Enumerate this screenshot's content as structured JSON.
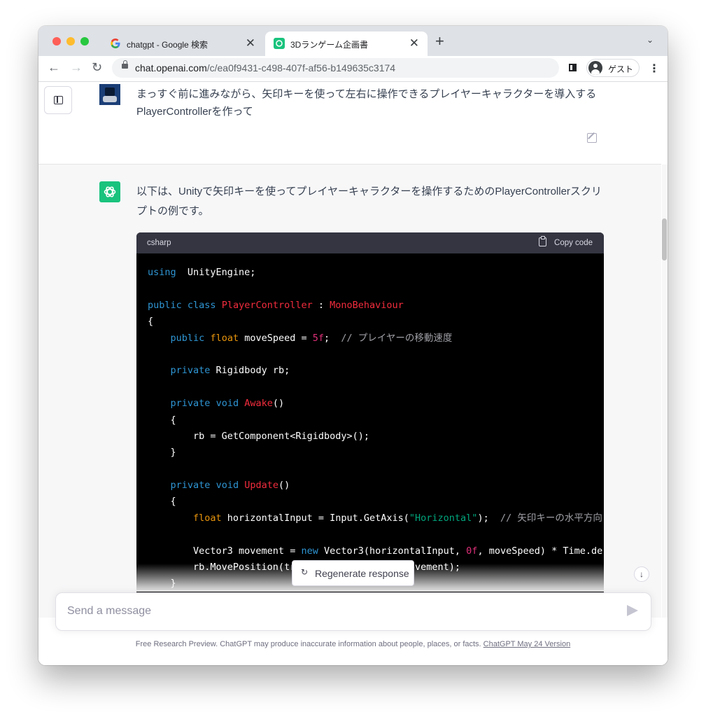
{
  "browser": {
    "tabs": [
      {
        "title": "chatgpt - Google 検索",
        "close": "✕"
      },
      {
        "title": "3Dランゲーム企画書",
        "close": "✕"
      }
    ],
    "new_tab": "+",
    "tab_menu": "⌄",
    "url_host": "chat.openai.com",
    "url_path": "/c/ea0f9431-c498-407f-af56-b149635c3174",
    "profile_label": "ゲスト",
    "menu": "⋮"
  },
  "chat": {
    "user_message": "まっすぐ前に進みながら、矢印キーを使って左右に操作できるプレイヤーキャラクターを導入するPlayerControllerを作って",
    "assistant_message": "以下は、Unityで矢印キーを使ってプレイヤーキャラクターを操作するためのPlayerControllerスクリプトの例です。",
    "code_language": "csharp",
    "copy_label": "Copy code",
    "regenerate_label": "Regenerate response",
    "input_placeholder": "Send a message",
    "footer_text": "Free Research Preview. ChatGPT may produce inaccurate information about people, places, or facts. ",
    "footer_link": "ChatGPT May 24 Version"
  },
  "code_lines": [
    [
      [
        "kw",
        "using"
      ],
      [
        "",
        "  UnityEngine;"
      ]
    ],
    [],
    [
      [
        "kw",
        "public"
      ],
      [
        "",
        " "
      ],
      [
        "kw",
        "class"
      ],
      [
        "",
        " "
      ],
      [
        "cls",
        "PlayerController"
      ],
      [
        "",
        " : "
      ],
      [
        "cls",
        "MonoBehaviour"
      ]
    ],
    [
      [
        "",
        "{"
      ]
    ],
    [
      [
        "",
        "    "
      ],
      [
        "kw",
        "public"
      ],
      [
        "",
        " "
      ],
      [
        "fl",
        "float"
      ],
      [
        "",
        " moveSpeed = "
      ],
      [
        "num",
        "5f"
      ],
      [
        "",
        ";  "
      ],
      [
        "cm",
        "// プレイヤーの移動速度"
      ]
    ],
    [],
    [
      [
        "",
        "    "
      ],
      [
        "kw",
        "private"
      ],
      [
        "",
        " Rigidbody rb;"
      ]
    ],
    [],
    [
      [
        "",
        "    "
      ],
      [
        "kw",
        "private"
      ],
      [
        "",
        " "
      ],
      [
        "kw",
        "void"
      ],
      [
        "",
        " "
      ],
      [
        "cls",
        "Awake"
      ],
      [
        "",
        "()"
      ]
    ],
    [
      [
        "",
        "    {"
      ]
    ],
    [
      [
        "",
        "        rb = GetComponent<Rigidbody>();"
      ]
    ],
    [
      [
        "",
        "    }"
      ]
    ],
    [],
    [
      [
        "",
        "    "
      ],
      [
        "kw",
        "private"
      ],
      [
        "",
        " "
      ],
      [
        "kw",
        "void"
      ],
      [
        "",
        " "
      ],
      [
        "cls",
        "Update"
      ],
      [
        "",
        "()"
      ]
    ],
    [
      [
        "",
        "    {"
      ]
    ],
    [
      [
        "",
        "        "
      ],
      [
        "fl",
        "float"
      ],
      [
        "",
        " horizontalInput = Input.GetAxis("
      ],
      [
        "str",
        "\"Horizontal\""
      ],
      [
        "",
        ");  "
      ],
      [
        "cm",
        "// 矢印キーの水平方向"
      ]
    ],
    [],
    [
      [
        "",
        "        Vector3 movement = "
      ],
      [
        "kw",
        "new"
      ],
      [
        "",
        " Vector3(horizontalInput, "
      ],
      [
        "num",
        "0f"
      ],
      [
        "",
        ", moveSpeed) * Time.de"
      ]
    ],
    [
      [
        "",
        "        rb.MovePosition(tr"
      ],
      [
        "",
        "ansform.position + movement);"
      ]
    ],
    [
      [
        "",
        "    }"
      ]
    ]
  ],
  "colors": {
    "accent_green": "#19c37d",
    "code_bg": "#000000",
    "code_header_bg": "#343541"
  },
  "icons": [
    "close-icon",
    "plus-icon",
    "lock-icon",
    "side-panel-icon",
    "profile-icon",
    "menu-icon",
    "sidebar-toggle-icon",
    "edit-icon",
    "chatgpt-logo-icon",
    "copy-icon",
    "regenerate-icon",
    "arrow-down-icon",
    "send-icon"
  ]
}
